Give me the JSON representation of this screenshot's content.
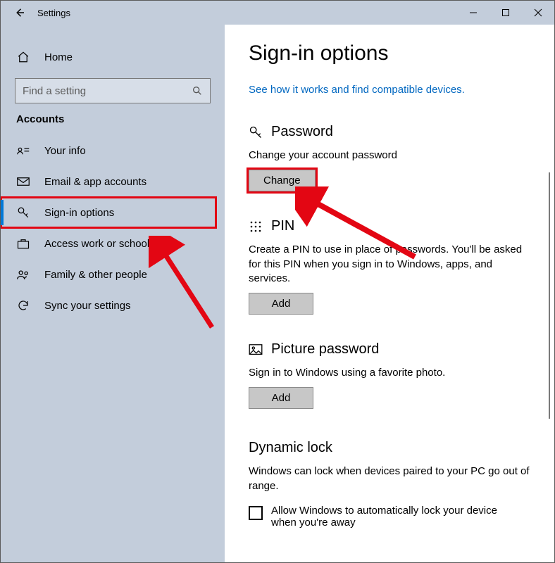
{
  "titlebar": {
    "title": "Settings"
  },
  "sidebar": {
    "home": "Home",
    "search_placeholder": "Find a setting",
    "section": "Accounts",
    "items": [
      {
        "label": "Your info"
      },
      {
        "label": "Email & app accounts"
      },
      {
        "label": "Sign-in options"
      },
      {
        "label": "Access work or school"
      },
      {
        "label": "Family & other people"
      },
      {
        "label": "Sync your settings"
      }
    ]
  },
  "main": {
    "title": "Sign-in options",
    "link": "See how it works and find compatible devices.",
    "password": {
      "heading": "Password",
      "desc": "Change your account password",
      "button": "Change"
    },
    "pin": {
      "heading": "PIN",
      "desc": "Create a PIN to use in place of passwords. You'll be asked for this PIN when you sign in to Windows, apps, and services.",
      "button": "Add"
    },
    "picture": {
      "heading": "Picture password",
      "desc": "Sign in to Windows using a favorite photo.",
      "button": "Add"
    },
    "dynamic": {
      "heading": "Dynamic lock",
      "desc": "Windows can lock when devices paired to your PC go out of range.",
      "checkbox": "Allow Windows to automatically lock your device when you're away"
    }
  }
}
